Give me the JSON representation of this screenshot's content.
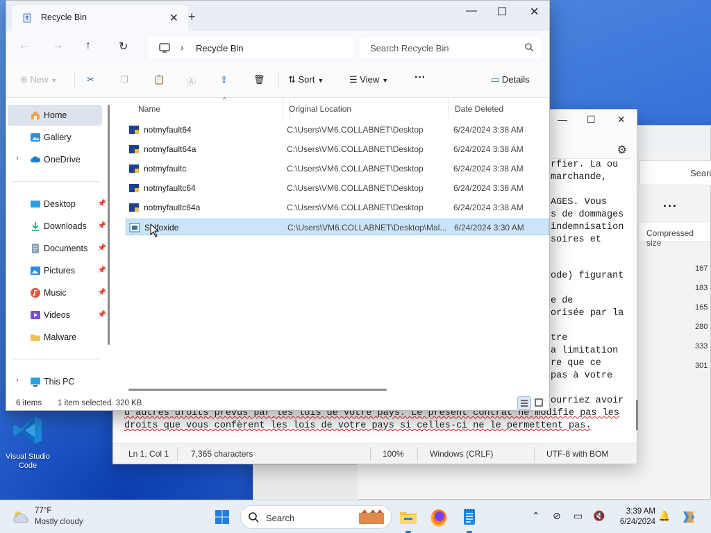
{
  "explorer": {
    "tab_title": "Recycle Bin",
    "breadcrumb": "Recycle Bin",
    "search_placeholder": "Search Recycle Bin",
    "toolbar": {
      "new_label": "New",
      "sort_label": "Sort",
      "view_label": "View",
      "more_label": "···",
      "details_label": "Details"
    },
    "nav": {
      "home": "Home",
      "gallery": "Gallery",
      "onedrive": "OneDrive",
      "desktop": "Desktop",
      "downloads": "Downloads",
      "documents": "Documents",
      "pictures": "Pictures",
      "music": "Music",
      "videos": "Videos",
      "malware": "Malware",
      "thispc": "This PC"
    },
    "columns": {
      "name": "Name",
      "original_location": "Original Location",
      "date_deleted": "Date Deleted"
    },
    "rows": [
      {
        "name": "notmyfault64",
        "location": "C:\\Users\\VM6.COLLABNET\\Desktop",
        "date": "6/24/2024 3:38 AM"
      },
      {
        "name": "notmyfault64a",
        "location": "C:\\Users\\VM6.COLLABNET\\Desktop",
        "date": "6/24/2024 3:38 AM"
      },
      {
        "name": "notmyfaultc",
        "location": "C:\\Users\\VM6.COLLABNET\\Desktop",
        "date": "6/24/2024 3:38 AM"
      },
      {
        "name": "notmyfaultc64",
        "location": "C:\\Users\\VM6.COLLABNET\\Desktop",
        "date": "6/24/2024 3:38 AM"
      },
      {
        "name": "notmyfaultc64a",
        "location": "C:\\Users\\VM6.COLLABNET\\Desktop",
        "date": "6/24/2024 3:38 AM"
      },
      {
        "name": "Sulfoxide",
        "location": "C:\\Users\\VM6.COLLABNET\\Desktop\\Mal...",
        "date": "6/24/2024 3:30 AM"
      }
    ],
    "status": {
      "item_count": "6 items",
      "selection": "1 item selected  320 KB"
    }
  },
  "notepad": {
    "lines": [
      "rfier. La ou",
      "marchande,",
      "",
      "AGES. Vous",
      "s de dommages",
      "indemnisation",
      "soires et",
      "",
      "",
      "ode) figurant",
      "",
      "e de",
      "orisée par la",
      "",
      "tre",
      "a limitation",
      "re que ce",
      "pas à votre",
      "",
      "ourriez avoir",
      "d'autres droits prévus par les lois de votre pays. Le présent contrat ne modifie pas les",
      "droits que vous confèrent les lois de votre pays si celles-ci ne le permettent pas."
    ],
    "status": {
      "position": "Ln 1, Col 1",
      "characters": "7,365 characters",
      "zoom": "100%",
      "line_ending": "Windows (CRLF)",
      "encoding": "UTF-8 with BOM"
    }
  },
  "background_window": {
    "search_label": "Searc",
    "more_label": "···",
    "column_header": "Compressed size",
    "sizes": [
      "167",
      "183",
      "165",
      "280",
      "333",
      "301"
    ]
  },
  "desktop": {
    "vscode_label_1": "Visual Studio",
    "vscode_label_2": "Code"
  },
  "taskbar": {
    "temperature": "77°F",
    "condition": "Mostly cloudy",
    "search_label": "Search",
    "time": "3:39 AM",
    "date": "6/24/2024"
  },
  "colors": {
    "accent": "#0067c0",
    "selection": "#cce4f7",
    "taskbar": "#e8eef6"
  }
}
